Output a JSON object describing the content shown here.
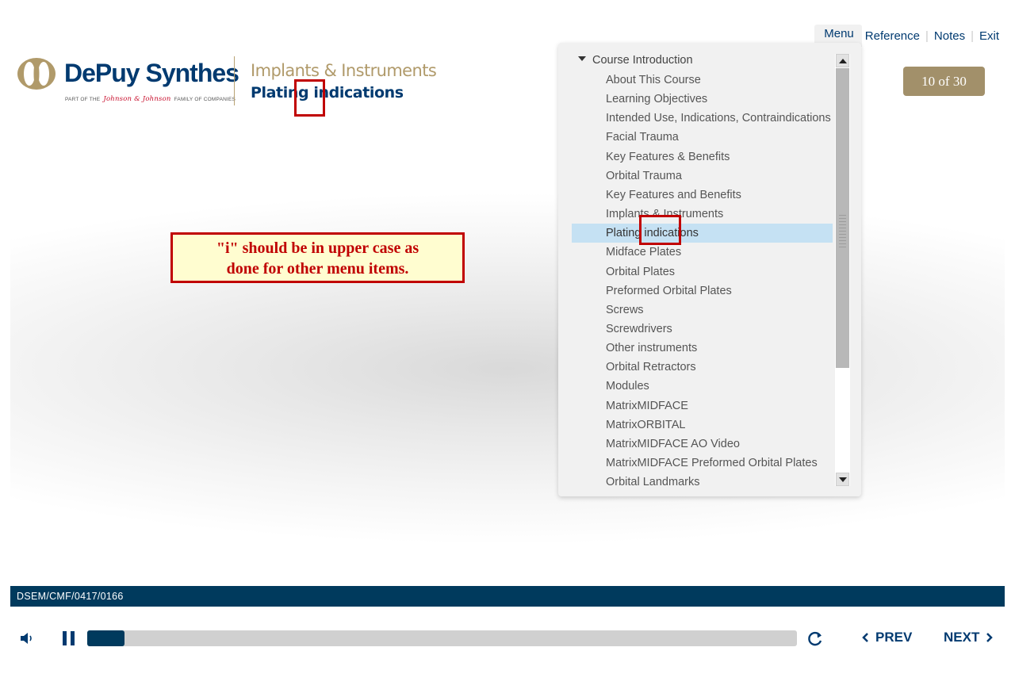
{
  "brand": {
    "name": "DePuy Synthes",
    "subline_prefix": "PART OF THE",
    "subline_jj": "Johnson & Johnson",
    "subline_suffix": "FAMILY OF COMPANIES"
  },
  "header": {
    "course_title": "Implants & Instruments",
    "slide_title": "Plating indications"
  },
  "topnav": {
    "menu": "Menu",
    "reference": "Reference",
    "notes": "Notes",
    "exit": "Exit",
    "separator": "|"
  },
  "page_counter": "10 of 30",
  "annotation": {
    "note_line1": "\"i\" should be in upper case as",
    "note_line2": "done for other menu items.",
    "color": "#c00000"
  },
  "menu": {
    "section": "Course Introduction",
    "active_index": 8,
    "items": [
      "About This Course",
      "Learning Objectives",
      "Intended Use, Indications, Contraindications",
      "Facial Trauma",
      "Key Features & Benefits",
      "Orbital Trauma",
      "Key Features and Benefits",
      "Implants & Instruments",
      "Plating indications",
      "Midface Plates",
      "Orbital Plates",
      "Preformed Orbital Plates",
      "Screws",
      "Screwdrivers",
      "Other instruments",
      "Orbital Retractors",
      "Modules",
      "MatrixMIDFACE",
      "MatrixORBITAL",
      "MatrixMIDFACE AO Video",
      "MatrixMIDFACE Preformed Orbital Plates",
      "Orbital Landmarks"
    ]
  },
  "footer": {
    "code": "DSEM/CMF/0417/0166"
  },
  "controls": {
    "progress": 0.053,
    "prev_label": "PREV",
    "next_label": "NEXT",
    "icons": [
      "volume-icon",
      "pause-icon",
      "replay-icon",
      "chevron-left-icon",
      "chevron-right-icon"
    ]
  },
  "colors": {
    "brand_blue": "#003a70",
    "gold": "#a2906a",
    "footer_bar": "#003a5d",
    "menu_highlight": "#c5e1f3"
  }
}
